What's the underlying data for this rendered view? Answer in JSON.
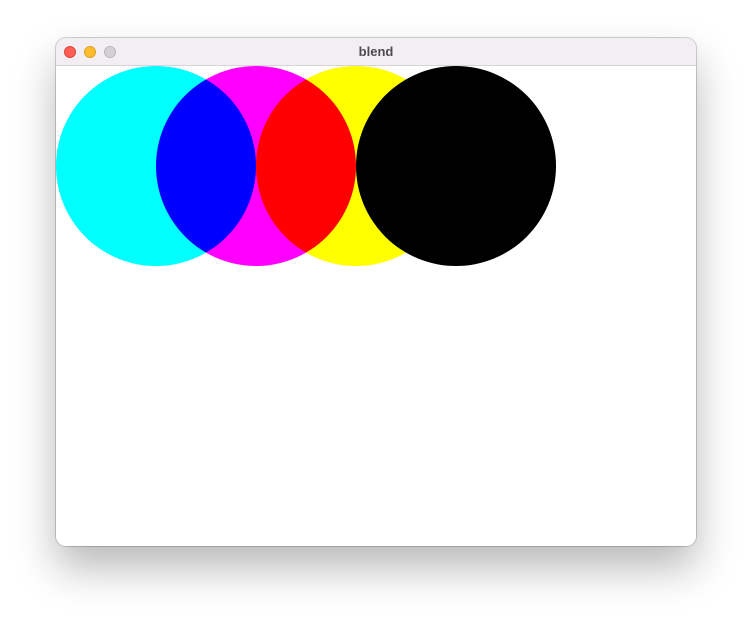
{
  "window": {
    "title": "blend",
    "controls": {
      "close": "close",
      "minimize": "minimize",
      "zoom": "zoom"
    }
  },
  "canvas": {
    "background_color": "#ffffff",
    "blend_mode": "multiply",
    "circles": [
      {
        "name": "cyan",
        "color": "#00ffff"
      },
      {
        "name": "magenta",
        "color": "#ff00ff"
      },
      {
        "name": "yellow",
        "color": "#ffff00"
      },
      {
        "name": "black",
        "color": "#000000"
      }
    ]
  }
}
